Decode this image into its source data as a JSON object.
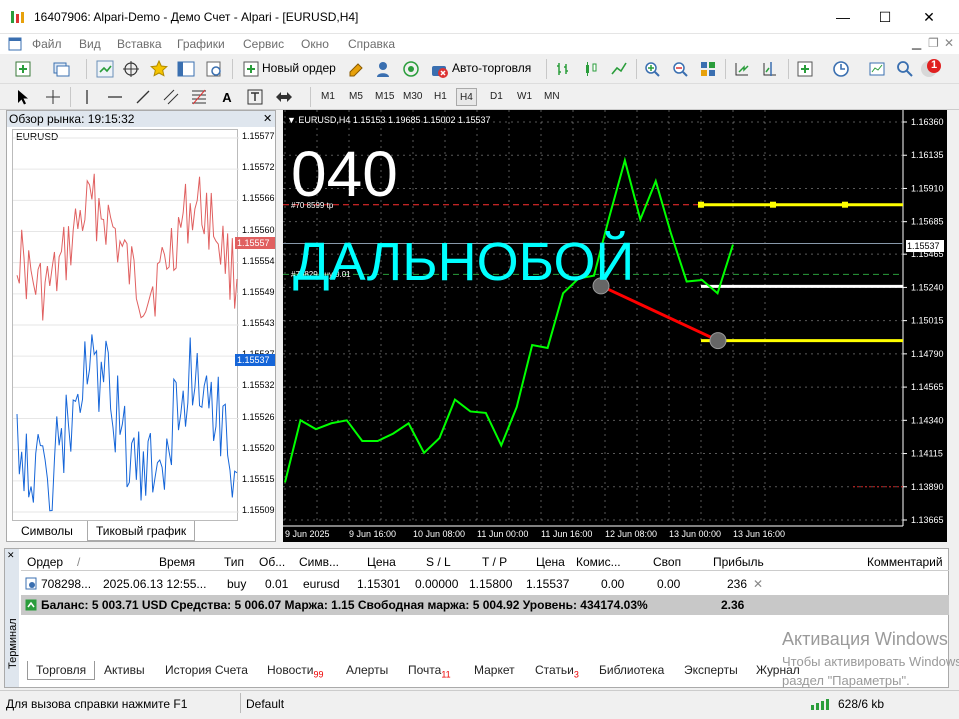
{
  "window": {
    "title": "16407906: Alpari-Demo - Демо Счет - Alpari - [EURUSD,H4]",
    "minimize": "—",
    "maximize": "☐",
    "close": "✕"
  },
  "menu": [
    "Файл",
    "Вид",
    "Вставка",
    "Графики",
    "Сервис",
    "Окно",
    "Справка"
  ],
  "toolbar": {
    "new_order": "Новый ордер",
    "auto_trading": "Авто-торговля",
    "notifications_badge": "1"
  },
  "timeframes": [
    "M1",
    "M5",
    "M15",
    "M30",
    "H1",
    "H4",
    "D1",
    "W1",
    "MN"
  ],
  "timeframe_selected": "H4",
  "market_watch": {
    "header": "Обзор рынка: 19:15:32",
    "symbol": "EURUSD",
    "tabs": [
      "Символы",
      "Тиковый график"
    ],
    "active_tab": "Тиковый график",
    "price_ticks": [
      "1.15577",
      "1.15572",
      "1.15566",
      "1.15560",
      "1.15554",
      "1.15549",
      "1.15543",
      "1.15537",
      "1.15532",
      "1.15526",
      "1.15520",
      "1.15515",
      "1.15509"
    ],
    "bid_label": "1.15557",
    "ask_label": "1.15537",
    "colors": {
      "ask_line": "#e06060",
      "bid_line": "#1565d8"
    }
  },
  "chart": {
    "header": "EURUSD,H4  1.15153 1.19685 1.15002 1.15537",
    "overlay_number": "040",
    "overlay_text": "ДАЛЬНОБОЙ",
    "tp_label": "#70   8599 tp",
    "buy_label": "#70829    buy 0.01",
    "current_price_label": "1.15537",
    "price_axis": [
      "1.16360",
      "1.16135",
      "1.15910",
      "1.15685",
      "1.15465",
      "1.15240",
      "1.15015",
      "1.14790",
      "1.14565",
      "1.14340",
      "1.14115",
      "1.13890",
      "1.13665"
    ],
    "time_axis": [
      "9 Jun 2025",
      "9 Jun 16:00",
      "10 Jun 08:00",
      "11 Jun 00:00",
      "11 Jun 16:00",
      "12 Jun 08:00",
      "13 Jun 00:00",
      "13 Jun 16:00"
    ],
    "colors": {
      "line": "#00ff00",
      "overlay_number": "#ffffff",
      "overlay_text": "#00ffff",
      "level": "#ffff00",
      "arrow": "#ff0000"
    }
  },
  "chart_data": {
    "type": "line",
    "symbol": "EURUSD",
    "timeframe": "H4",
    "x": [
      "9 Jun 2025",
      "9 Jun 16:00",
      "10 Jun 08:00",
      "11 Jun 00:00",
      "11 Jun 16:00",
      "12 Jun 08:00",
      "13 Jun 00:00",
      "13 Jun 16:00"
    ],
    "series": [
      {
        "values": [
          1.1392,
          1.1434,
          1.1428,
          1.1432,
          1.1434,
          1.142,
          1.142,
          1.1425,
          1.1432,
          1.1412,
          1.1422,
          1.1448,
          1.144,
          1.1439,
          1.1417,
          1.1443,
          1.1485,
          1.1483,
          1.152,
          1.153,
          1.1532,
          1.1572,
          1.161,
          1.157,
          1.1596,
          1.156,
          1.1528,
          1.1529,
          1.152,
          1.1553
        ]
      }
    ],
    "ylim": [
      1.13665,
      1.1636
    ],
    "levels": [
      {
        "label": "tp",
        "value": 1.158
      },
      {
        "label": "buy",
        "value": 1.15301
      },
      {
        "label": "",
        "value": 1.1488
      }
    ]
  },
  "terminal": {
    "side_label": "Терминал",
    "columns": [
      "Ордер",
      "/",
      "Время",
      "Тип",
      "Об...",
      "Симв...",
      "Цена",
      "S / L",
      "T / P",
      "Цена",
      "Комис...",
      "Своп",
      "Прибыль",
      "Комментарий"
    ],
    "row": {
      "order": "708298...",
      "time": "2025.06.13 12:55...",
      "type": "buy",
      "volume": "0.01",
      "symbol": "eurusd",
      "open_price": "1.15301",
      "sl": "0.00000",
      "tp": "1.15800",
      "price": "1.15537",
      "commission": "0.00",
      "swap": "0.00",
      "profit": "236"
    },
    "balance_line": "Баланс: 5 003.71 USD  Средства: 5 006.07  Маржа: 1.15  Свободная маржа: 5 004.92  Уровень: 434174.03%",
    "balance_profit": "2.36",
    "tabs": [
      {
        "label": "Торговля",
        "badge": ""
      },
      {
        "label": "Активы",
        "badge": ""
      },
      {
        "label": "История Счета",
        "badge": ""
      },
      {
        "label": "Новости",
        "badge": "99"
      },
      {
        "label": "Алерты",
        "badge": ""
      },
      {
        "label": "Почта",
        "badge": "11"
      },
      {
        "label": "Маркет",
        "badge": ""
      },
      {
        "label": "Статьи",
        "badge": "3"
      },
      {
        "label": "Библиотека",
        "badge": ""
      },
      {
        "label": "Эксперты",
        "badge": ""
      },
      {
        "label": "Журнал",
        "badge": ""
      }
    ]
  },
  "watermark": {
    "line1": "Активация Windows",
    "line2": "Чтобы активировать Windows, перейдите в",
    "line3": "раздел \"Параметры\"."
  },
  "status": {
    "help": "Для вызова справки нажмите F1",
    "profile": "Default",
    "traffic": "628/6 kb"
  }
}
